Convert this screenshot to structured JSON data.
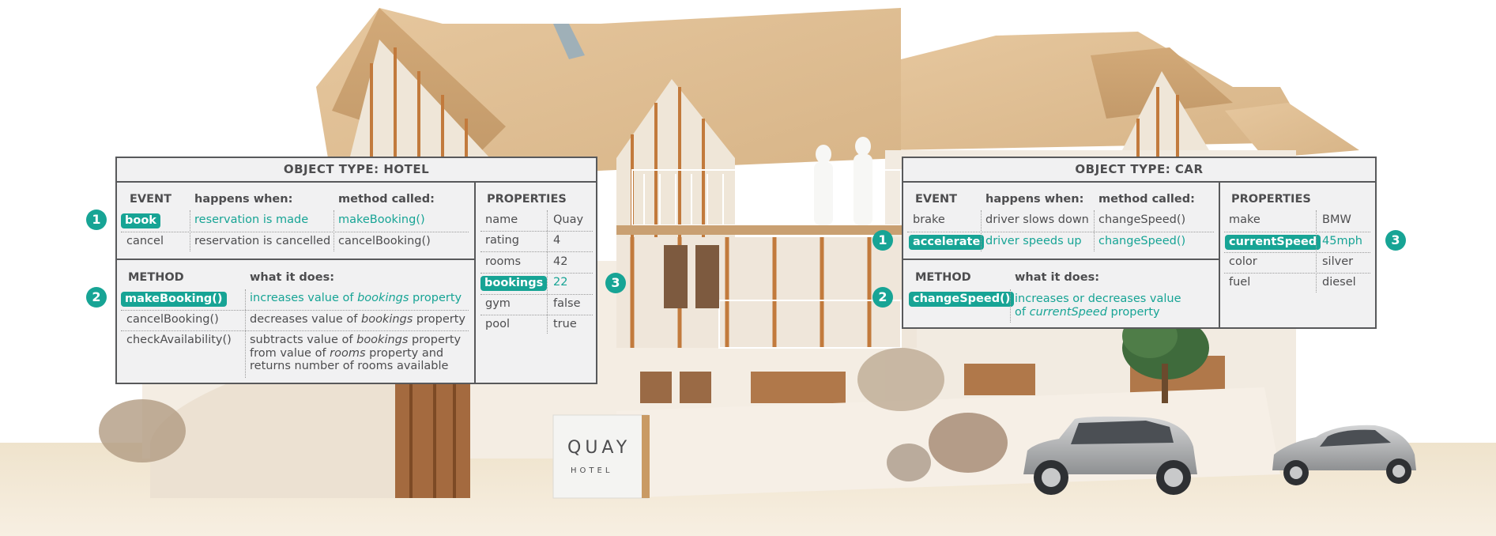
{
  "hotel": {
    "title": "OBJECT TYPE: HOTEL",
    "event_header": "EVENT",
    "happens_header": "happens when:",
    "called_header": "method called:",
    "events": [
      {
        "name": "book",
        "happens": "reservation is made",
        "called": "makeBooking()",
        "highlight": true,
        "marker": "1"
      },
      {
        "name": "cancel",
        "happens": "reservation is cancelled",
        "called": "cancelBooking()",
        "highlight": false
      }
    ],
    "method_header": "METHOD",
    "does_header": "what it does:",
    "methods": [
      {
        "name": "makeBooking()",
        "does_pre": "increases value of ",
        "does_em": "bookings",
        "does_post": " property",
        "highlight": true,
        "marker": "2"
      },
      {
        "name": "cancelBooking()",
        "does_pre": "decreases value of ",
        "does_em": "bookings",
        "does_post": " property",
        "highlight": false
      },
      {
        "name": "checkAvailability()",
        "does_line1_pre": "subtracts value of ",
        "does_line1_em": "bookings",
        "does_line1_post": " property",
        "does_line2_pre": "from value of ",
        "does_line2_em": "rooms",
        "does_line2_post": " property and",
        "does_line3": "returns number of rooms available",
        "highlight": false
      }
    ],
    "properties_header": "PROPERTIES",
    "properties": [
      {
        "name": "name",
        "value": "Quay"
      },
      {
        "name": "rating",
        "value": "4"
      },
      {
        "name": "rooms",
        "value": "42"
      },
      {
        "name": "bookings",
        "value": "22",
        "highlight": true,
        "marker": "3"
      },
      {
        "name": "gym",
        "value": "false"
      },
      {
        "name": "pool",
        "value": "true"
      }
    ]
  },
  "car": {
    "title": "OBJECT TYPE: CAR",
    "event_header": "EVENT",
    "happens_header": "happens when:",
    "called_header": "method called:",
    "events": [
      {
        "name": "brake",
        "happens": "driver slows down",
        "called": "changeSpeed()",
        "highlight": false
      },
      {
        "name": "accelerate",
        "happens": "driver speeds up",
        "called": "changeSpeed()",
        "highlight": true,
        "marker": "1"
      }
    ],
    "method_header": "METHOD",
    "does_header": "what it does:",
    "methods": [
      {
        "name": "changeSpeed()",
        "does_line1": "increases or decreases value",
        "does_line2_pre": "of ",
        "does_line2_em": "currentSpeed",
        "does_line2_post": " property",
        "highlight": true,
        "marker": "2"
      }
    ],
    "properties_header": "PROPERTIES",
    "properties": [
      {
        "name": "make",
        "value": "BMW"
      },
      {
        "name": "currentSpeed",
        "value": "45mph",
        "highlight": true,
        "marker": "3"
      },
      {
        "name": "color",
        "value": "silver"
      },
      {
        "name": "fuel",
        "value": "diesel"
      }
    ]
  },
  "sign": {
    "line1": "QUAY",
    "line2": "HOTEL"
  },
  "colors": {
    "accent": "#17a495",
    "panel_bg": "#f1f1f2",
    "border": "#58595b",
    "text": "#4d4d4f"
  }
}
